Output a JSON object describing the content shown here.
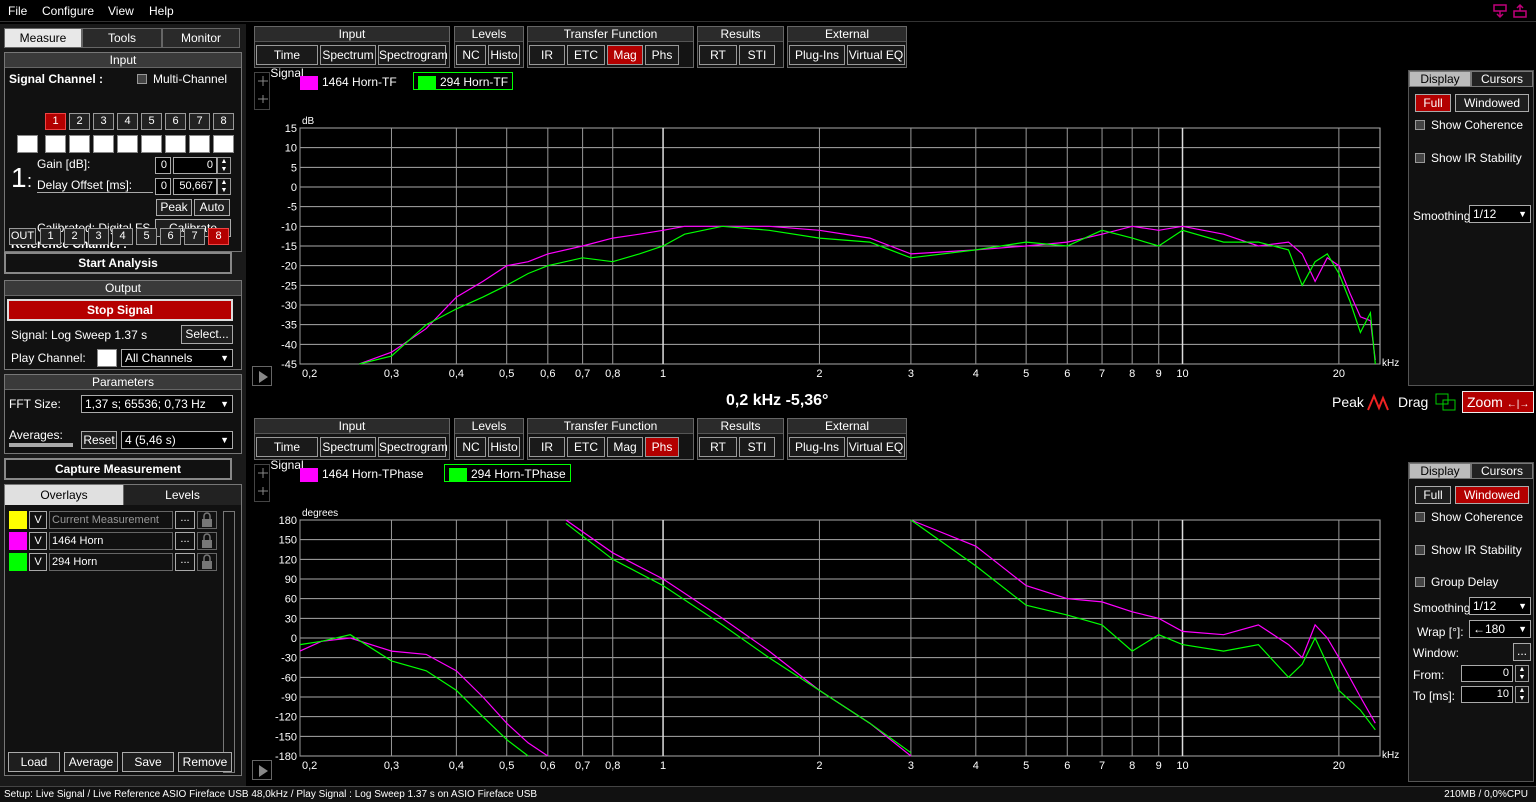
{
  "menu": [
    "File",
    "Configure",
    "View",
    "Help"
  ],
  "left_tabs": [
    "Measure",
    "Tools",
    "Monitor"
  ],
  "input": {
    "title": "Input",
    "signal_channel_label": "Signal Channel :",
    "multi_channel_label": "Multi-Channel",
    "channels": [
      "1",
      "2",
      "3",
      "4",
      "5",
      "6",
      "7",
      "8"
    ],
    "channel_number": "1",
    "gain_label": "Gain [dB]:",
    "gain_coarse": "0",
    "gain_value": "0",
    "delay_label": "Delay Offset [ms]:",
    "delay_coarse": "0",
    "delay_value": "50,667",
    "peak": "Peak",
    "auto": "Auto",
    "calibrated_text": "Calibrated: Digital FS",
    "calibrate_btn": "Calibrate",
    "reference_label": "Reference Channel :",
    "ref_channels": [
      "OUT",
      "1",
      "2",
      "3",
      "4",
      "5",
      "6",
      "7",
      "8"
    ]
  },
  "start_analysis": "Start Analysis",
  "output": {
    "title": "Output",
    "stop_signal": "Stop Signal",
    "signal_text": "Signal: Log Sweep  1.37 s",
    "select_btn": "Select...",
    "play_channel_label": "Play Channel:",
    "play_channel_value": "All Channels"
  },
  "parameters": {
    "title": "Parameters",
    "fft_label": "FFT Size:",
    "fft_value": "1,37 s; 65536; 0,73 Hz",
    "averages_label": "Averages:",
    "reset": "Reset",
    "averages_value": "4 (5,46 s)"
  },
  "capture": "Capture Measurement",
  "overlay_tabs": [
    "Overlays",
    "Levels"
  ],
  "overlays": [
    {
      "color": "#ffff00",
      "v": "V",
      "name": "Current Measurement",
      "dim": true
    },
    {
      "color": "#ff00ff",
      "v": "V",
      "name": "1464 Horn",
      "dim": false
    },
    {
      "color": "#00ff00",
      "v": "V",
      "name": "294 Horn",
      "dim": false
    }
  ],
  "overlay_more": "...",
  "bottom_buttons": [
    "Load",
    "Average",
    "Save",
    "Remove"
  ],
  "toolbar": {
    "groups": [
      {
        "title": "Input",
        "buttons": [
          "Time Signal",
          "Spectrum",
          "Spectrogram"
        ]
      },
      {
        "title": "Levels",
        "buttons": [
          "NC",
          "Histo"
        ]
      },
      {
        "title": "Transfer Function",
        "buttons": [
          "IR",
          "ETC",
          "Mag",
          "Phs"
        ]
      },
      {
        "title": "Results",
        "buttons": [
          "RT",
          "STI"
        ]
      },
      {
        "title": "External",
        "buttons": [
          "Plug-Ins",
          "Virtual EQ"
        ]
      }
    ],
    "top_active": "Mag",
    "bottom_active": "Phs"
  },
  "top_legend": [
    "1464 Horn-TF",
    "294 Horn-TF"
  ],
  "bottom_legend": [
    "1464 Horn-TPhase",
    "294 Horn-TPhase"
  ],
  "readout": "0,2 kHz   -5,36°",
  "peak_label": "Peak",
  "drag_label": "Drag",
  "zoom_label": "Zoom",
  "right_top": {
    "tabs": [
      "Display",
      "Cursors"
    ],
    "full": "Full",
    "windowed": "Windowed",
    "show_coherence": "Show Coherence",
    "show_ir": "Show IR Stability",
    "smoothing_label": "Smoothing:",
    "smoothing_value": "1/12"
  },
  "right_bottom": {
    "tabs": [
      "Display",
      "Cursors"
    ],
    "full": "Full",
    "windowed": "Windowed",
    "show_coherence": "Show Coherence",
    "show_ir": "Show IR Stability",
    "group_delay": "Group Delay",
    "smoothing_label": "Smoothing:",
    "smoothing_value": "1/12",
    "wrap_label": "Wrap [°]:",
    "wrap_value": "←180",
    "window_label": "Window:",
    "window_btn": "...",
    "from_label": "From:",
    "from_value": "0",
    "to_label": "To [ms]:",
    "to_value": "10"
  },
  "status_left": "Setup: Live Signal / Live Reference ASIO Fireface USB 48,0kHz / Play Signal : Log Sweep  1.37 s on ASIO Fireface USB",
  "status_right": "210MB / 0,0%CPU",
  "colors": {
    "series1": "#ff00ff",
    "series2": "#00ff00",
    "active": "#b30000"
  },
  "chart_data": [
    {
      "type": "line",
      "ylabel": "dB",
      "xlabel": "kHz",
      "x_scale": "log",
      "xlim": [
        0.2,
        24
      ],
      "ylim": [
        -45,
        15
      ],
      "yticks": [
        15,
        10,
        5,
        0,
        -5,
        -10,
        -15,
        -20,
        -25,
        -30,
        -35,
        -40,
        -45
      ],
      "xticks": [
        0.2,
        0.3,
        0.4,
        0.5,
        0.6,
        0.7,
        0.8,
        1,
        2,
        3,
        4,
        5,
        6,
        7,
        8,
        9,
        10,
        20
      ],
      "xtick_labels": [
        "0,2",
        "0,3",
        "0,4",
        "0,5",
        "0,6",
        "0,7",
        "0,8",
        "1",
        "2",
        "3",
        "4",
        "5",
        "6",
        "7",
        "8",
        "9",
        "10",
        "20"
      ],
      "grid": true,
      "series": [
        {
          "name": "1464 Horn-TF",
          "x": [
            0.26,
            0.3,
            0.35,
            0.4,
            0.45,
            0.5,
            0.55,
            0.6,
            0.7,
            0.8,
            0.9,
            1.0,
            1.1,
            1.3,
            1.6,
            2.0,
            2.5,
            3.0,
            4.0,
            5.0,
            6.0,
            7.0,
            8.0,
            9.0,
            10,
            12,
            14,
            16,
            17,
            18,
            19,
            20,
            21,
            22,
            23,
            23.5
          ],
          "y": [
            -45,
            -42,
            -36,
            -28,
            -24,
            -20,
            -19,
            -17,
            -15,
            -13,
            -12,
            -11,
            -10,
            -10,
            -10,
            -11,
            -13,
            -17,
            -16,
            -15,
            -14,
            -12,
            -10,
            -11,
            -10,
            -12,
            -15,
            -14,
            -17,
            -24,
            -18,
            -20,
            -27,
            -33,
            -34,
            -44
          ]
        },
        {
          "name": "294 Horn-TF",
          "x": [
            0.26,
            0.3,
            0.35,
            0.4,
            0.45,
            0.5,
            0.55,
            0.6,
            0.7,
            0.8,
            0.9,
            1.0,
            1.1,
            1.3,
            1.6,
            2.0,
            2.5,
            3.0,
            4.0,
            5.0,
            6.0,
            7.0,
            8.0,
            9.0,
            10,
            12,
            14,
            16,
            17,
            18,
            19,
            20,
            21,
            22,
            23,
            23.5
          ],
          "y": [
            -45,
            -43,
            -35,
            -31,
            -28,
            -25,
            -22,
            -20,
            -18,
            -19,
            -17,
            -15,
            -12,
            -10,
            -11,
            -13,
            -14,
            -18,
            -16,
            -14,
            -15,
            -11,
            -13,
            -15,
            -11,
            -14,
            -14,
            -16,
            -25,
            -19,
            -17,
            -22,
            -29,
            -37,
            -32,
            -45
          ]
        }
      ]
    },
    {
      "type": "line",
      "ylabel": "degrees",
      "xlabel": "kHz",
      "x_scale": "log",
      "xlim": [
        0.2,
        24
      ],
      "ylim": [
        -180,
        180
      ],
      "yticks": [
        180,
        150,
        120,
        90,
        60,
        30,
        0,
        -30,
        -60,
        -90,
        -120,
        -150,
        -180
      ],
      "xticks": [
        0.2,
        0.3,
        0.4,
        0.5,
        0.6,
        0.7,
        0.8,
        1,
        2,
        3,
        4,
        5,
        6,
        7,
        8,
        9,
        10,
        20
      ],
      "xtick_labels": [
        "0,2",
        "0,3",
        "0,4",
        "0,5",
        "0,6",
        "0,7",
        "0,8",
        "1",
        "2",
        "3",
        "4",
        "5",
        "6",
        "7",
        "8",
        "9",
        "10",
        "20"
      ],
      "grid": true,
      "series": [
        {
          "name": "1464 Horn-TPhase",
          "segments": [
            {
              "x": [
                0.2,
                0.22,
                0.25,
                0.3,
                0.35,
                0.4,
                0.45,
                0.5,
                0.55,
                0.6
              ],
              "y": [
                -20,
                -5,
                0,
                -20,
                -25,
                -50,
                -90,
                -130,
                -160,
                -180
              ]
            },
            {
              "x": [
                0.65,
                0.8,
                1.0,
                1.3,
                1.6,
                2.0,
                2.5,
                3.0
              ],
              "y": [
                180,
                130,
                90,
                30,
                -20,
                -80,
                -130,
                -180
              ]
            },
            {
              "x": [
                3.0,
                4.0,
                5.0,
                6.0,
                7.0,
                8.0,
                9.0,
                10,
                12,
                14,
                16,
                17,
                18,
                19,
                20,
                22,
                23.5
              ],
              "y": [
                180,
                140,
                80,
                60,
                55,
                40,
                30,
                10,
                5,
                20,
                -10,
                -30,
                20,
                0,
                -30,
                -90,
                -130
              ]
            }
          ]
        },
        {
          "name": "294 Horn-TPhase",
          "segments": [
            {
              "x": [
                0.2,
                0.22,
                0.25,
                0.3,
                0.35,
                0.4,
                0.45,
                0.5,
                0.55
              ],
              "y": [
                -10,
                -5,
                5,
                -35,
                -50,
                -80,
                -120,
                -155,
                -180
              ]
            },
            {
              "x": [
                0.65,
                0.8,
                1.0,
                1.3,
                1.6,
                2.0,
                2.5,
                3.0
              ],
              "y": [
                175,
                120,
                80,
                20,
                -30,
                -80,
                -130,
                -175
              ]
            },
            {
              "x": [
                3.0,
                4.0,
                5.0,
                6.0,
                7.0,
                8.0,
                9.0,
                10,
                12,
                14,
                16,
                17,
                18,
                19,
                20,
                22,
                23.5
              ],
              "y": [
                180,
                110,
                50,
                35,
                20,
                -20,
                5,
                -10,
                -20,
                -10,
                -60,
                -40,
                0,
                -40,
                -80,
                -110,
                -140
              ]
            }
          ]
        }
      ]
    }
  ]
}
